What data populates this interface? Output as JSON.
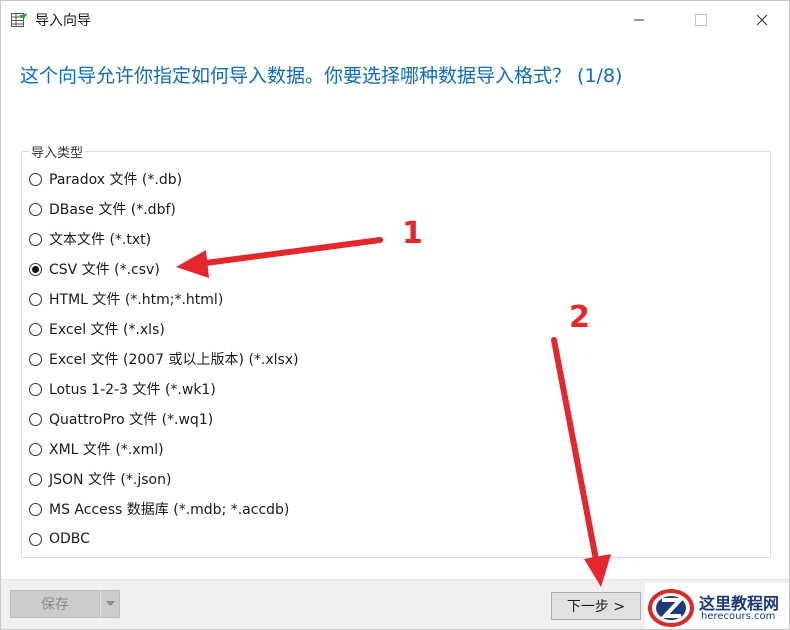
{
  "window": {
    "title": "导入向导"
  },
  "headline": "这个向导允许你指定如何导入数据。你要选择哪种数据导入格式？ (1/8)",
  "group": {
    "title": "导入类型",
    "selected_index": 3,
    "options": [
      "Paradox 文件 (*.db)",
      "DBase 文件 (*.dbf)",
      "文本文件 (*.txt)",
      "CSV 文件 (*.csv)",
      "HTML 文件 (*.htm;*.html)",
      "Excel 文件 (*.xls)",
      "Excel 文件 (2007 或以上版本) (*.xlsx)",
      "Lotus 1-2-3 文件 (*.wk1)",
      "QuattroPro 文件 (*.wq1)",
      "XML 文件 (*.xml)",
      "JSON 文件 (*.json)",
      "MS Access 数据库 (*.mdb; *.accdb)",
      "ODBC"
    ]
  },
  "buttons": {
    "save_label": "保存",
    "next_label": "下一步 >"
  },
  "annotations": {
    "step1": "1",
    "step2": "2",
    "color": "#e5272d"
  },
  "watermark": {
    "name_cn": "这里教程网",
    "url": "herecours.com"
  },
  "colors": {
    "headline": "#0f6cbd",
    "bottom_bar": "#f0f0f0"
  }
}
